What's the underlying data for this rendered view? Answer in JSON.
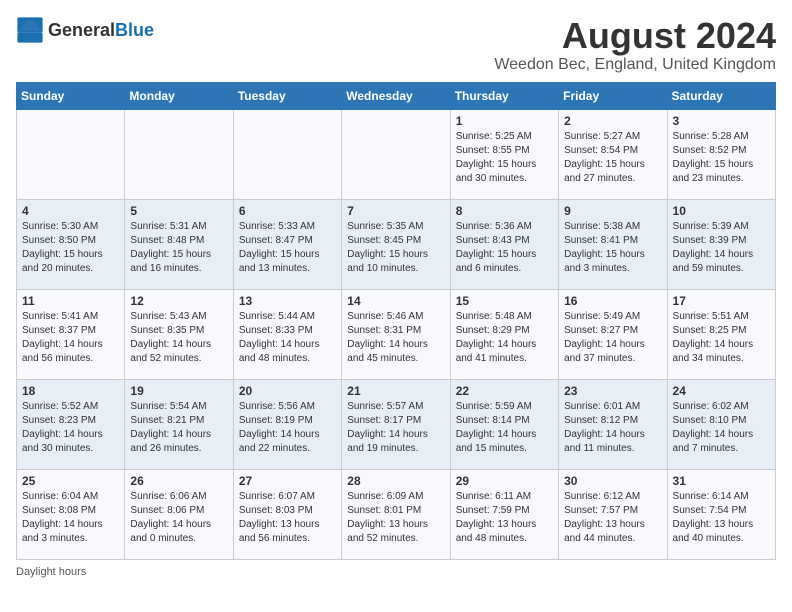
{
  "header": {
    "logo_general": "General",
    "logo_blue": "Blue",
    "title": "August 2024",
    "subtitle": "Weedon Bec, England, United Kingdom"
  },
  "columns": [
    "Sunday",
    "Monday",
    "Tuesday",
    "Wednesday",
    "Thursday",
    "Friday",
    "Saturday"
  ],
  "weeks": [
    [
      {
        "day": "",
        "info": ""
      },
      {
        "day": "",
        "info": ""
      },
      {
        "day": "",
        "info": ""
      },
      {
        "day": "",
        "info": ""
      },
      {
        "day": "1",
        "info": "Sunrise: 5:25 AM\nSunset: 8:55 PM\nDaylight: 15 hours and 30 minutes."
      },
      {
        "day": "2",
        "info": "Sunrise: 5:27 AM\nSunset: 8:54 PM\nDaylight: 15 hours and 27 minutes."
      },
      {
        "day": "3",
        "info": "Sunrise: 5:28 AM\nSunset: 8:52 PM\nDaylight: 15 hours and 23 minutes."
      }
    ],
    [
      {
        "day": "4",
        "info": "Sunrise: 5:30 AM\nSunset: 8:50 PM\nDaylight: 15 hours and 20 minutes."
      },
      {
        "day": "5",
        "info": "Sunrise: 5:31 AM\nSunset: 8:48 PM\nDaylight: 15 hours and 16 minutes."
      },
      {
        "day": "6",
        "info": "Sunrise: 5:33 AM\nSunset: 8:47 PM\nDaylight: 15 hours and 13 minutes."
      },
      {
        "day": "7",
        "info": "Sunrise: 5:35 AM\nSunset: 8:45 PM\nDaylight: 15 hours and 10 minutes."
      },
      {
        "day": "8",
        "info": "Sunrise: 5:36 AM\nSunset: 8:43 PM\nDaylight: 15 hours and 6 minutes."
      },
      {
        "day": "9",
        "info": "Sunrise: 5:38 AM\nSunset: 8:41 PM\nDaylight: 15 hours and 3 minutes."
      },
      {
        "day": "10",
        "info": "Sunrise: 5:39 AM\nSunset: 8:39 PM\nDaylight: 14 hours and 59 minutes."
      }
    ],
    [
      {
        "day": "11",
        "info": "Sunrise: 5:41 AM\nSunset: 8:37 PM\nDaylight: 14 hours and 56 minutes."
      },
      {
        "day": "12",
        "info": "Sunrise: 5:43 AM\nSunset: 8:35 PM\nDaylight: 14 hours and 52 minutes."
      },
      {
        "day": "13",
        "info": "Sunrise: 5:44 AM\nSunset: 8:33 PM\nDaylight: 14 hours and 48 minutes."
      },
      {
        "day": "14",
        "info": "Sunrise: 5:46 AM\nSunset: 8:31 PM\nDaylight: 14 hours and 45 minutes."
      },
      {
        "day": "15",
        "info": "Sunrise: 5:48 AM\nSunset: 8:29 PM\nDaylight: 14 hours and 41 minutes."
      },
      {
        "day": "16",
        "info": "Sunrise: 5:49 AM\nSunset: 8:27 PM\nDaylight: 14 hours and 37 minutes."
      },
      {
        "day": "17",
        "info": "Sunrise: 5:51 AM\nSunset: 8:25 PM\nDaylight: 14 hours and 34 minutes."
      }
    ],
    [
      {
        "day": "18",
        "info": "Sunrise: 5:52 AM\nSunset: 8:23 PM\nDaylight: 14 hours and 30 minutes."
      },
      {
        "day": "19",
        "info": "Sunrise: 5:54 AM\nSunset: 8:21 PM\nDaylight: 14 hours and 26 minutes."
      },
      {
        "day": "20",
        "info": "Sunrise: 5:56 AM\nSunset: 8:19 PM\nDaylight: 14 hours and 22 minutes."
      },
      {
        "day": "21",
        "info": "Sunrise: 5:57 AM\nSunset: 8:17 PM\nDaylight: 14 hours and 19 minutes."
      },
      {
        "day": "22",
        "info": "Sunrise: 5:59 AM\nSunset: 8:14 PM\nDaylight: 14 hours and 15 minutes."
      },
      {
        "day": "23",
        "info": "Sunrise: 6:01 AM\nSunset: 8:12 PM\nDaylight: 14 hours and 11 minutes."
      },
      {
        "day": "24",
        "info": "Sunrise: 6:02 AM\nSunset: 8:10 PM\nDaylight: 14 hours and 7 minutes."
      }
    ],
    [
      {
        "day": "25",
        "info": "Sunrise: 6:04 AM\nSunset: 8:08 PM\nDaylight: 14 hours and 3 minutes."
      },
      {
        "day": "26",
        "info": "Sunrise: 6:06 AM\nSunset: 8:06 PM\nDaylight: 14 hours and 0 minutes."
      },
      {
        "day": "27",
        "info": "Sunrise: 6:07 AM\nSunset: 8:03 PM\nDaylight: 13 hours and 56 minutes."
      },
      {
        "day": "28",
        "info": "Sunrise: 6:09 AM\nSunset: 8:01 PM\nDaylight: 13 hours and 52 minutes."
      },
      {
        "day": "29",
        "info": "Sunrise: 6:11 AM\nSunset: 7:59 PM\nDaylight: 13 hours and 48 minutes."
      },
      {
        "day": "30",
        "info": "Sunrise: 6:12 AM\nSunset: 7:57 PM\nDaylight: 13 hours and 44 minutes."
      },
      {
        "day": "31",
        "info": "Sunrise: 6:14 AM\nSunset: 7:54 PM\nDaylight: 13 hours and 40 minutes."
      }
    ]
  ],
  "footer": "Daylight hours"
}
